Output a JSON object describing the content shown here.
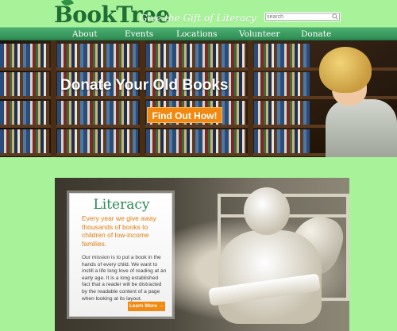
{
  "header": {
    "logo": "BookTree",
    "tagline": "Give the Gift of Literacy",
    "search_placeholder": "search"
  },
  "nav": {
    "items": [
      {
        "label": "About"
      },
      {
        "label": "Events"
      },
      {
        "label": "Locations"
      },
      {
        "label": "Volunteer"
      },
      {
        "label": "Donate"
      }
    ]
  },
  "hero": {
    "title": "Donate Your Old Books",
    "button_label": "Find Out How!"
  },
  "feature": {
    "card_title": "Literacy",
    "lead": "Every year we give away thousands of books to children of low-income families.",
    "body": "Our mission is to put a book in the hands of every child. We want to instill a life long love of reading at an early age. It is a long established fact that a reader will be distracted by the readable content of a page when looking at its layout.",
    "button_label": "Learn More →"
  },
  "colors": {
    "page_background": "#a8f29a",
    "nav_green": "#2d8a52",
    "logo_green": "#1f6e34",
    "accent_orange": "#f08a12"
  }
}
